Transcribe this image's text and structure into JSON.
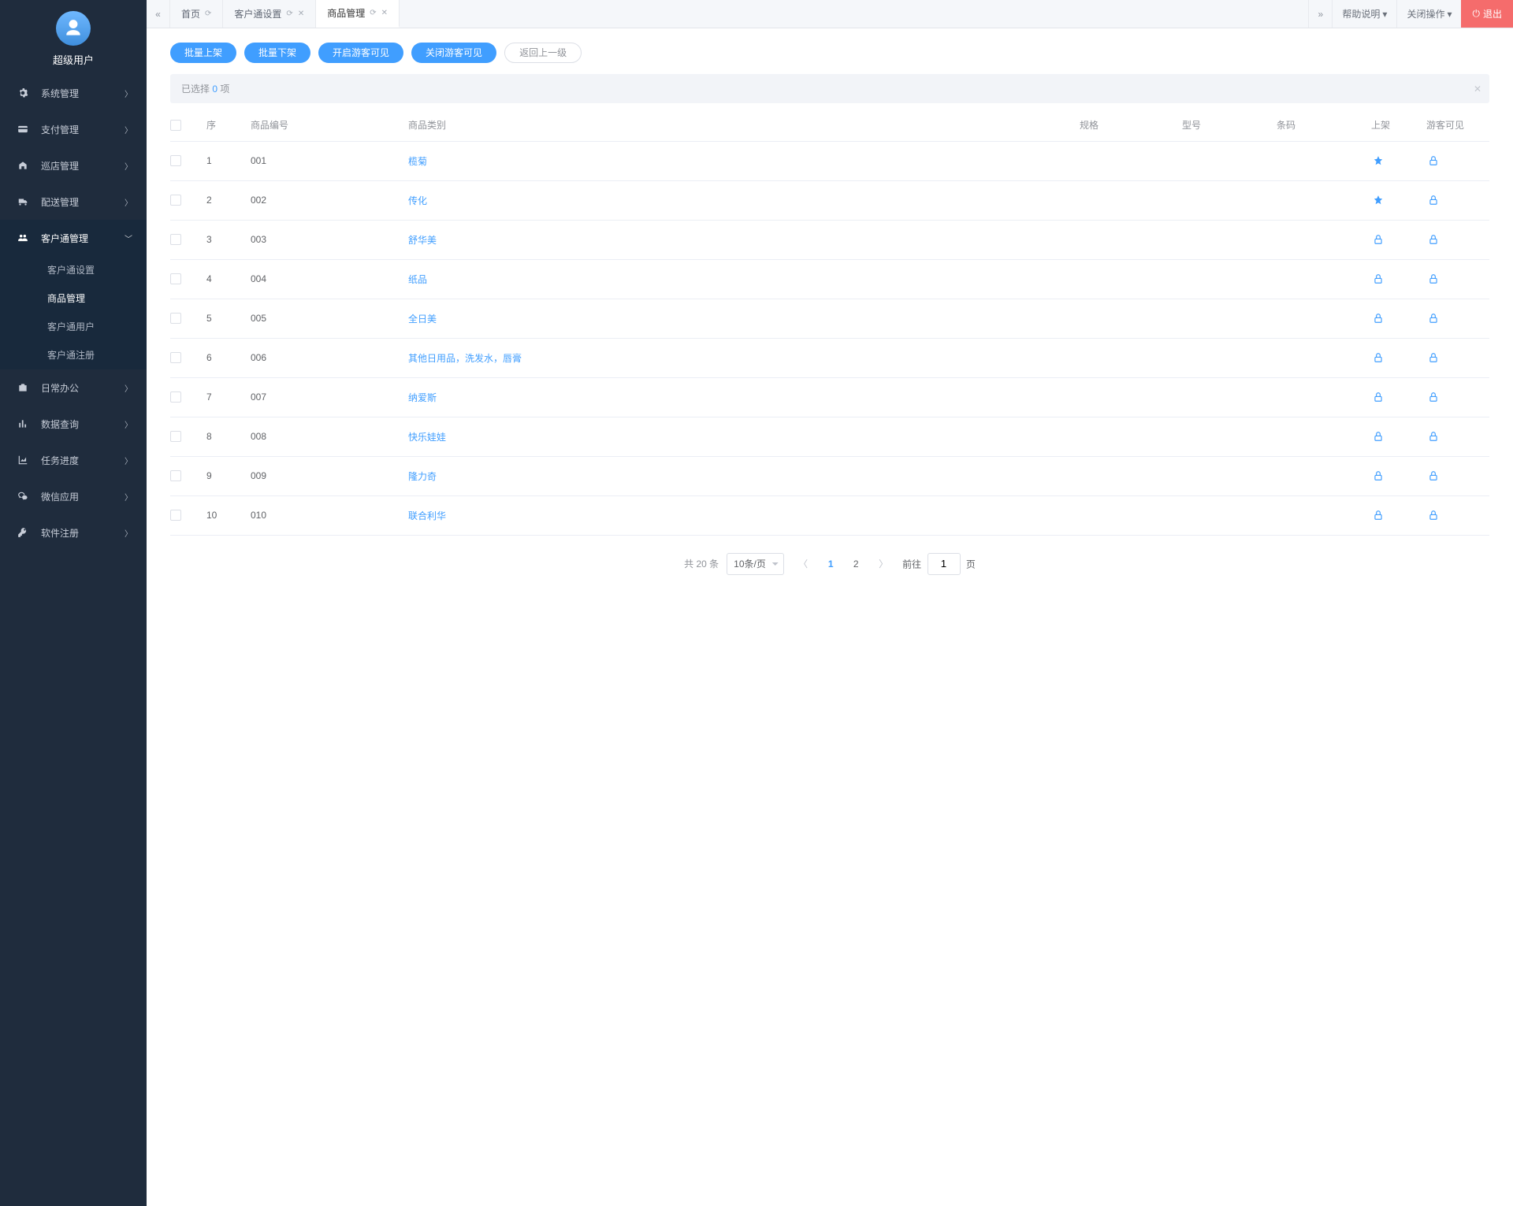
{
  "user": {
    "name": "超级用户"
  },
  "sidebar": {
    "items": [
      {
        "label": "系统管理"
      },
      {
        "label": "支付管理"
      },
      {
        "label": "巡店管理"
      },
      {
        "label": "配送管理"
      },
      {
        "label": "客户通管理",
        "children": [
          {
            "label": "客户通设置"
          },
          {
            "label": "商品管理"
          },
          {
            "label": "客户通用户"
          },
          {
            "label": "客户通注册"
          }
        ]
      },
      {
        "label": "日常办公"
      },
      {
        "label": "数据查询"
      },
      {
        "label": "任务进度"
      },
      {
        "label": "微信应用"
      },
      {
        "label": "软件注册"
      }
    ]
  },
  "tabs": {
    "items": [
      {
        "label": "首页"
      },
      {
        "label": "客户通设置"
      },
      {
        "label": "商品管理"
      }
    ],
    "right": {
      "help": "帮助说明",
      "closeOps": "关闭操作",
      "exit": "退出"
    }
  },
  "toolbar": {
    "batchOn": "批量上架",
    "batchOff": "批量下架",
    "openGuest": "开启游客可见",
    "closeGuest": "关闭游客可见",
    "back": "返回上一级"
  },
  "selinfo": {
    "prefix": "已选择 ",
    "count": "0",
    "suffix": " 项"
  },
  "columns": {
    "idx": "序",
    "num": "商品编号",
    "cat": "商品类别",
    "spec": "规格",
    "model": "型号",
    "barcode": "条码",
    "listed": "上架",
    "guest": "游客可见"
  },
  "rows": [
    {
      "idx": "1",
      "num": "001",
      "cat": "榄菊",
      "star": true
    },
    {
      "idx": "2",
      "num": "002",
      "cat": "传化",
      "star": true
    },
    {
      "idx": "3",
      "num": "003",
      "cat": "舒华美"
    },
    {
      "idx": "4",
      "num": "004",
      "cat": "纸品"
    },
    {
      "idx": "5",
      "num": "005",
      "cat": "全日美"
    },
    {
      "idx": "6",
      "num": "006",
      "cat": "其他日用品，洗发水，唇膏"
    },
    {
      "idx": "7",
      "num": "007",
      "cat": "纳爱斯"
    },
    {
      "idx": "8",
      "num": "008",
      "cat": "快乐娃娃"
    },
    {
      "idx": "9",
      "num": "009",
      "cat": "隆力奇"
    },
    {
      "idx": "10",
      "num": "010",
      "cat": "联合利华"
    }
  ],
  "pager": {
    "totalPrefix": "共 ",
    "total": "20",
    "totalSuffix": " 条",
    "pageSize": "10条/页",
    "pages": [
      "1",
      "2"
    ],
    "current": "1",
    "jumpPrefix": "前往",
    "jumpValue": "1",
    "jumpSuffix": "页"
  }
}
